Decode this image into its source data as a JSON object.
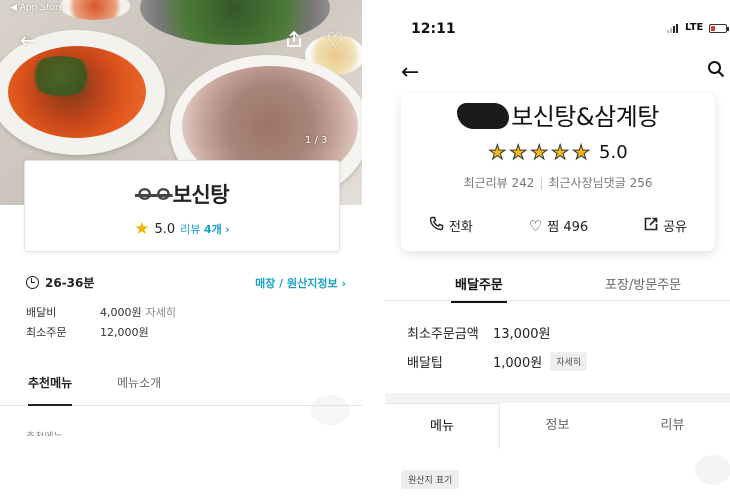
{
  "left_screen": {
    "status_back_label": "◀ App Store",
    "photo_counter": "1 / 3",
    "store_name_scribbled": "ㅇㅇ",
    "store_name": "보신탕",
    "rating": "5.0",
    "review_label": "리뷰",
    "review_count": "4개",
    "review_chevron": "›",
    "delivery_time": "26-36분",
    "origin_link": "매장 / 원산지정보 ›",
    "delivery_fee_label": "배달비",
    "delivery_fee_value": "4,000원",
    "delivery_fee_detail": "자세히",
    "min_order_label": "최소주문",
    "min_order_value": "12,000원",
    "tabs": [
      "추천메뉴",
      "메뉴소개"
    ],
    "cut_off_text": "추천메뉴"
  },
  "right_screen": {
    "status_time": "12:11",
    "network": "LTE",
    "store_name": "보신탕&삼계탕",
    "rating": "5.0",
    "recent_reviews": "최근리뷰 242",
    "owner_replies": "최근사장님댓글 256",
    "actions": {
      "call": "전화",
      "like": "찜 496",
      "share": "공유"
    },
    "order_tabs": [
      "배달주문",
      "포장/방문주문"
    ],
    "min_order_label": "최소주문금액",
    "min_order_value": "13,000원",
    "delivery_tip_label": "배달팁",
    "delivery_tip_value": "1,000원",
    "delivery_tip_detail": "자세히",
    "content_tabs": [
      "메뉴",
      "정보",
      "리뷰"
    ],
    "origin_chip": "원산지 표기"
  },
  "icons": {
    "star": "★",
    "back": "←",
    "heart": "♡"
  },
  "colors": {
    "accent_link": "#1aa0c8",
    "star_yellow": "#f4b400",
    "battery_low": "#e0382a"
  }
}
